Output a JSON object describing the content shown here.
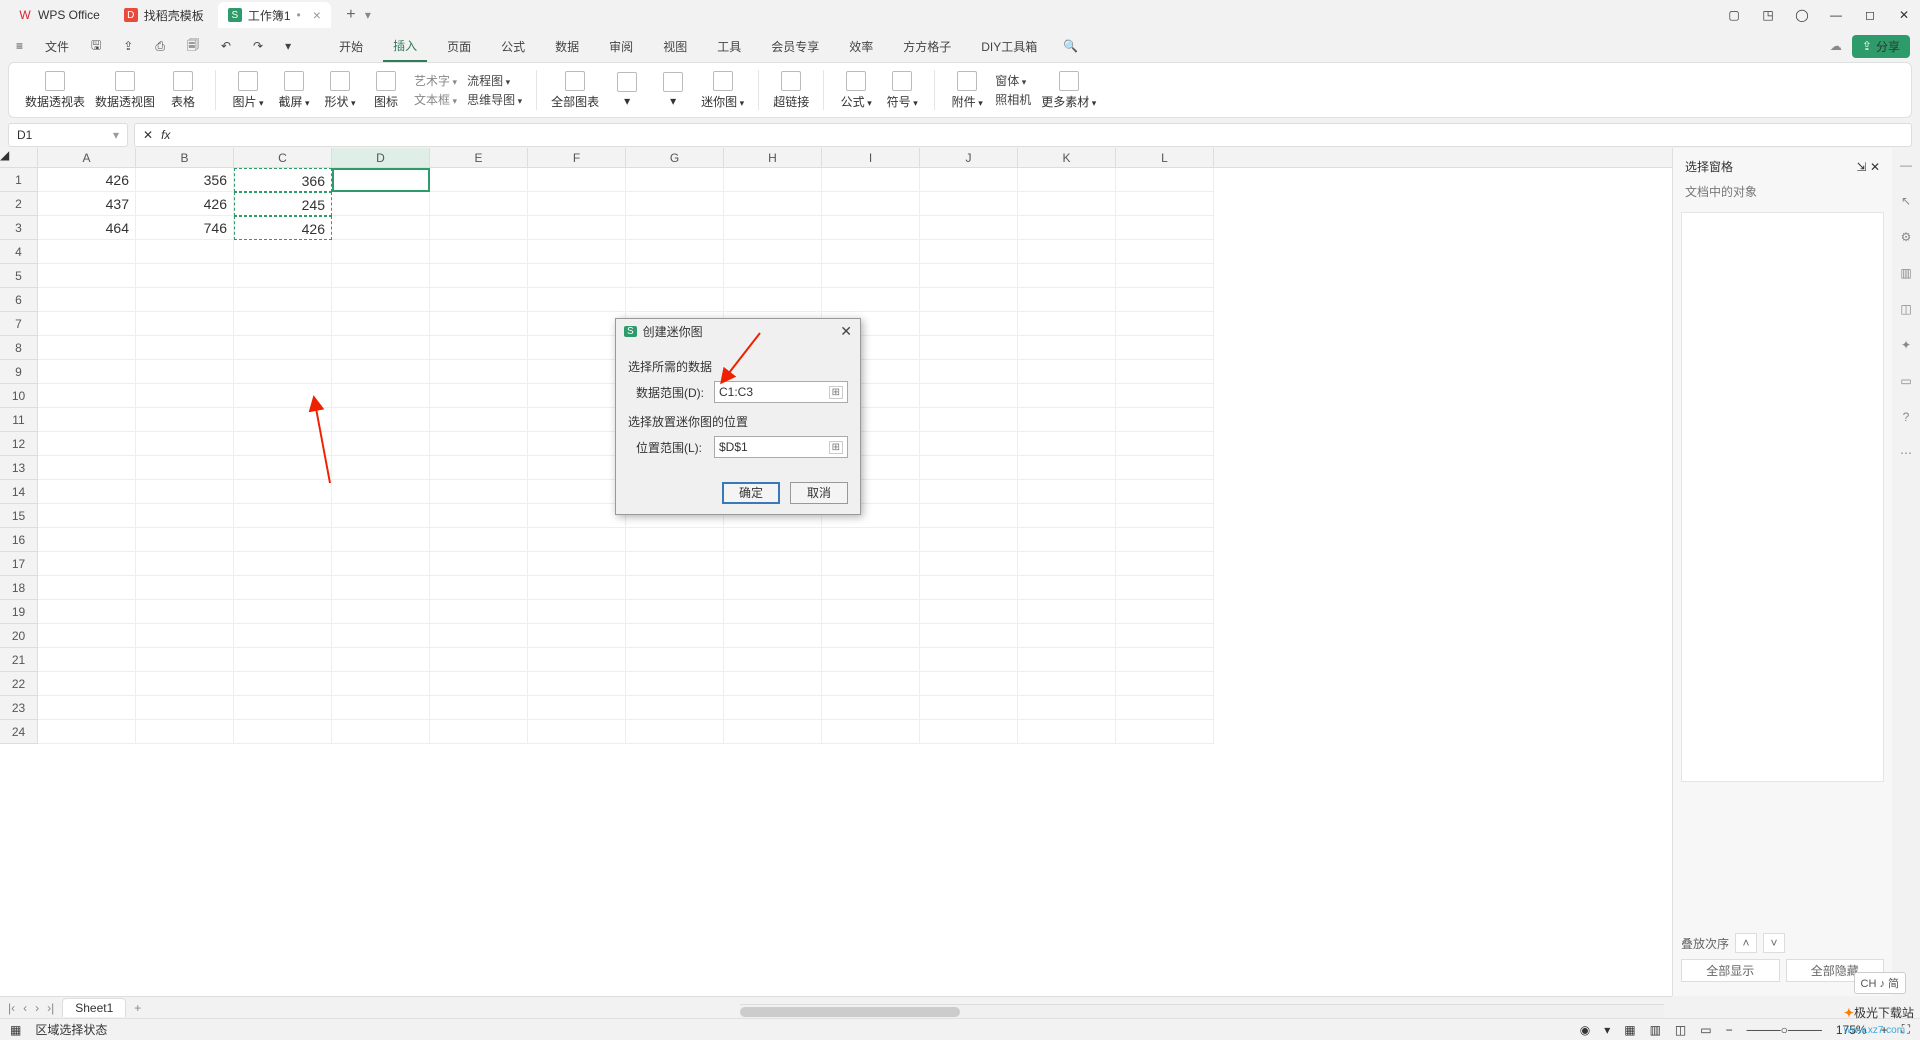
{
  "tabs": {
    "app": "WPS Office",
    "template": "找稻壳模板",
    "workbook": "工作簿1"
  },
  "menu": {
    "file": "文件",
    "items": [
      "开始",
      "插入",
      "页面",
      "公式",
      "数据",
      "审阅",
      "视图",
      "工具",
      "会员专享",
      "效率",
      "方方格子",
      "DIY工具箱"
    ],
    "active": "插入",
    "share": "分享"
  },
  "ribbon": {
    "pivottable": "数据透视表",
    "pivotchart": "数据透视图",
    "table": "表格",
    "picture": "图片",
    "screenshot": "截屏",
    "shape": "形状",
    "icon": "图标",
    "artword": "艺术字",
    "textbox": "文本框",
    "flowchart": "流程图",
    "mindmap": "思维导图",
    "allcharts": "全部图表",
    "sparkline": "迷你图",
    "hyperlink": "超链接",
    "formula": "公式",
    "symbol": "符号",
    "attachment": "附件",
    "form": "窗体",
    "camera": "照相机",
    "more": "更多素材"
  },
  "namebox": {
    "cell": "D1"
  },
  "columns": [
    "A",
    "B",
    "C",
    "D",
    "E",
    "F",
    "G",
    "H",
    "I",
    "J",
    "K",
    "L"
  ],
  "grid": {
    "r1": {
      "A": "426",
      "B": "356",
      "C": "366"
    },
    "r2": {
      "A": "437",
      "B": "426",
      "C": "245"
    },
    "r3": {
      "A": "464",
      "B": "746",
      "C": "426"
    }
  },
  "dialog": {
    "title": "创建迷你图",
    "section1": "选择所需的数据",
    "dataRangeLabel": "数据范围(D):",
    "dataRangeValue": "C1:C3",
    "section2": "选择放置迷你图的位置",
    "locRangeLabel": "位置范围(L):",
    "locRangeValue": "$D$1",
    "ok": "确定",
    "cancel": "取消"
  },
  "sheet": {
    "name": "Sheet1"
  },
  "status": {
    "mode": "区域选择状态",
    "zoom": "175%"
  },
  "sidepanel": {
    "title": "选择窗格",
    "objects": "文档中的对象",
    "stackorder": "叠放次序",
    "showall": "全部显示",
    "hideall": "全部隐藏"
  },
  "ime": "CH ♪ 简",
  "watermark": {
    "brand": "极光下载站",
    "url": "www.xz7.com"
  }
}
